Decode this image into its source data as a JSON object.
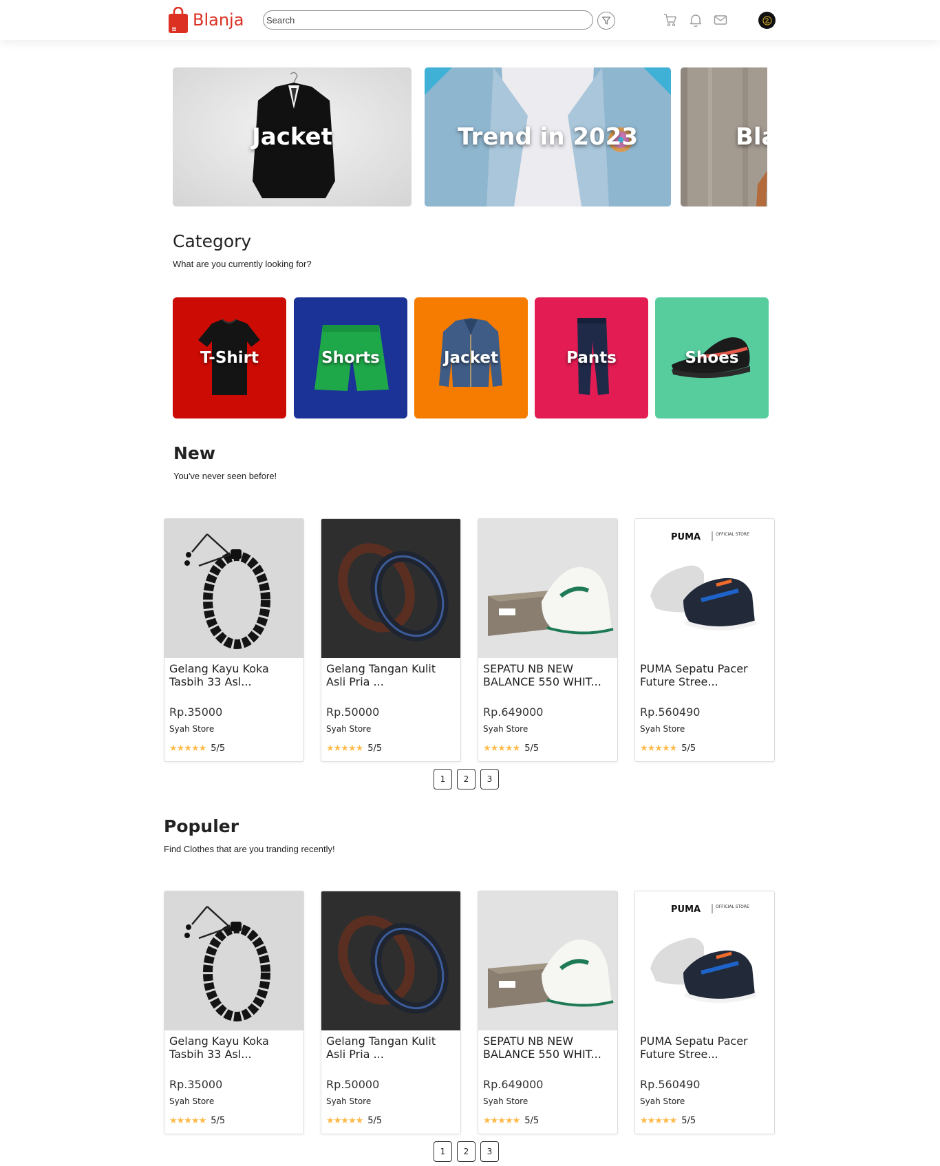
{
  "brand": {
    "name": "Blanja",
    "color": "#db3022"
  },
  "search": {
    "placeholder": "Search",
    "value": ""
  },
  "nav_icons": [
    "filter-icon",
    "cart-icon",
    "bell-icon",
    "mail-icon",
    "avatar"
  ],
  "banners": [
    {
      "title": "Jacket"
    },
    {
      "title": "Trend in 2023"
    },
    {
      "title": "Bla"
    }
  ],
  "category": {
    "title": "Category",
    "subtitle": "What are you currently looking for?",
    "items": [
      {
        "label": "T-Shirt",
        "color": "#cc0b04"
      },
      {
        "label": "Shorts",
        "color": "#1b3397"
      },
      {
        "label": "Jacket",
        "color": "#f57c00"
      },
      {
        "label": "Pants",
        "color": "#e31c53"
      },
      {
        "label": "Shoes",
        "color": "#57cd9e"
      }
    ]
  },
  "new_section": {
    "title": "New",
    "subtitle": "You've never seen before!",
    "products": [
      {
        "name": "Gelang Kayu Koka Tasbih 33 Asl...",
        "price": "Rp.35000",
        "store": "Syah Store",
        "rating": "5/5"
      },
      {
        "name": "Gelang Tangan Kulit Asli Pria ...",
        "price": "Rp.50000",
        "store": "Syah Store",
        "rating": "5/5"
      },
      {
        "name": "SEPATU NB NEW BALANCE 550 WHIT...",
        "price": "Rp.649000",
        "store": "Syah Store",
        "rating": "5/5"
      },
      {
        "name": "PUMA Sepatu Pacer Future Stree...",
        "price": "Rp.560490",
        "store": "Syah Store",
        "rating": "5/5"
      }
    ],
    "pages": [
      "1",
      "2",
      "3"
    ]
  },
  "popular_section": {
    "title": "Populer",
    "subtitle": "Find Clothes that are you tranding recently!",
    "products": [
      {
        "name": "Gelang Kayu Koka Tasbih 33 Asl...",
        "price": "Rp.35000",
        "store": "Syah Store",
        "rating": "5/5"
      },
      {
        "name": "Gelang Tangan Kulit Asli Pria ...",
        "price": "Rp.50000",
        "store": "Syah Store",
        "rating": "5/5"
      },
      {
        "name": "SEPATU NB NEW BALANCE 550 WHIT...",
        "price": "Rp.649000",
        "store": "Syah Store",
        "rating": "5/5"
      },
      {
        "name": "PUMA Sepatu Pacer Future Stree...",
        "price": "Rp.560490",
        "store": "Syah Store",
        "rating": "5/5"
      }
    ],
    "pages": [
      "1",
      "2",
      "3"
    ]
  },
  "puma_logo": {
    "brand": "PUMA",
    "tag": "OFFICIAL STORE"
  },
  "rating_color": "#ffba49"
}
